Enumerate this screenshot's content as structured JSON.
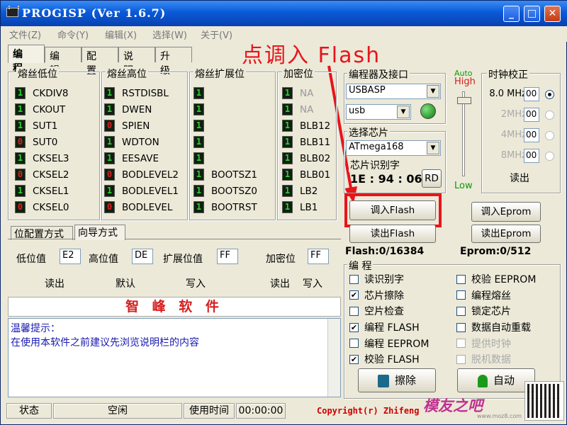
{
  "window": {
    "title": "PROGISP  (Ver 1.6.7)",
    "controls": {
      "minimize": "_",
      "maximize": "□",
      "close": "✕"
    }
  },
  "menu": [
    "文件(Z)",
    "命令(Y)",
    "编辑(X)",
    "选择(W)",
    "关于(V)"
  ],
  "tabs": [
    "编 程",
    "编 辑",
    "配 置",
    "说 明",
    "升 级"
  ],
  "annotation": "点调入 Flash",
  "fuse_groups": {
    "low": {
      "title": "熔丝低位",
      "rows": [
        {
          "v": "1",
          "n": "CKDIV8"
        },
        {
          "v": "1",
          "n": "CKOUT"
        },
        {
          "v": "1",
          "n": "SUT1"
        },
        {
          "v": "0",
          "n": "SUT0"
        },
        {
          "v": "1",
          "n": "CKSEL3"
        },
        {
          "v": "0",
          "n": "CKSEL2"
        },
        {
          "v": "1",
          "n": "CKSEL1"
        },
        {
          "v": "0",
          "n": "CKSEL0"
        }
      ]
    },
    "high": {
      "title": "熔丝高位",
      "rows": [
        {
          "v": "1",
          "n": "RSTDISBL"
        },
        {
          "v": "1",
          "n": "DWEN"
        },
        {
          "v": "0",
          "n": "SPIEN"
        },
        {
          "v": "1",
          "n": "WDTON"
        },
        {
          "v": "1",
          "n": "EESAVE"
        },
        {
          "v": "0",
          "n": "BODLEVEL2"
        },
        {
          "v": "1",
          "n": "BODLEVEL1"
        },
        {
          "v": "0",
          "n": "BODLEVEL"
        }
      ]
    },
    "ext": {
      "title": "熔丝扩展位",
      "rows": [
        {
          "v": "1",
          "n": ""
        },
        {
          "v": "1",
          "n": ""
        },
        {
          "v": "1",
          "n": ""
        },
        {
          "v": "1",
          "n": ""
        },
        {
          "v": "1",
          "n": ""
        },
        {
          "v": "1",
          "n": "BOOTSZ1"
        },
        {
          "v": "1",
          "n": "BOOTSZ0"
        },
        {
          "v": "1",
          "n": "BOOTRST"
        }
      ]
    },
    "lock": {
      "title": "加密位",
      "rows": [
        {
          "v": "1",
          "n": "NA",
          "dis": true
        },
        {
          "v": "1",
          "n": "NA",
          "dis": true
        },
        {
          "v": "1",
          "n": "BLB12"
        },
        {
          "v": "1",
          "n": "BLB11"
        },
        {
          "v": "1",
          "n": "BLB02"
        },
        {
          "v": "1",
          "n": "BLB01"
        },
        {
          "v": "1",
          "n": "LB2"
        },
        {
          "v": "1",
          "n": "LB1"
        }
      ]
    }
  },
  "config_tabs": [
    "位配置方式",
    "向导方式"
  ],
  "values": {
    "low_label": "低位值",
    "low": "E2",
    "high_label": "高位值",
    "high": "DE",
    "ext_label": "扩展位值",
    "ext": "FF",
    "lock_label": "加密位",
    "lock": "FF"
  },
  "value_buttons": [
    "读出",
    "默认",
    "写入",
    "读出",
    "写入"
  ],
  "brand": "智 峰 软 件",
  "log": [
    "温馨提示：",
    "在使用本软件之前建议先浏览说明栏的内容"
  ],
  "programmer": {
    "title": "编程器及接口",
    "device": "USBASP",
    "port": "usb",
    "auto": "Auto",
    "high": "High",
    "low": "Low"
  },
  "chip": {
    "title": "选择芯片",
    "name": "ATmega168",
    "id_title": "芯片识别字",
    "id": "1E : 94 : 06",
    "rd": "RD"
  },
  "clock": {
    "title": "时钟校正",
    "options": [
      {
        "f": "8.0 MHz",
        "v": "00",
        "on": true,
        "dis": false
      },
      {
        "f": "2MHz",
        "v": "00",
        "on": false,
        "dis": true
      },
      {
        "f": "4MHz",
        "v": "00",
        "on": false,
        "dis": true
      },
      {
        "f": "8MHz",
        "v": "00",
        "on": false,
        "dis": true
      }
    ],
    "read": "读出"
  },
  "flash_buttons": {
    "load_flash": "调入Flash",
    "read_flash": "读出Flash",
    "load_eprom": "调入Eprom",
    "read_eprom": "读出Eprom"
  },
  "sizes": {
    "flash": "Flash:0/16384",
    "eprom": "Eprom:0/512"
  },
  "program": {
    "title": "编 程",
    "left": [
      {
        "label": "读识别字",
        "checked": false,
        "dis": false
      },
      {
        "label": "芯片擦除",
        "checked": true,
        "dis": false
      },
      {
        "label": "空片检查",
        "checked": false,
        "dis": false
      },
      {
        "label": "编程 FLASH",
        "checked": true,
        "dis": false
      },
      {
        "label": "编程 EEPROM",
        "checked": false,
        "dis": false
      },
      {
        "label": "校验 FLASH",
        "checked": true,
        "dis": false
      }
    ],
    "right": [
      {
        "label": "校验 EEPROM",
        "checked": false,
        "dis": false
      },
      {
        "label": "编程熔丝",
        "checked": false,
        "dis": false
      },
      {
        "label": "锁定芯片",
        "checked": false,
        "dis": false
      },
      {
        "label": "数据自动重载",
        "checked": false,
        "dis": false
      },
      {
        "label": "提供时钟",
        "checked": false,
        "dis": true
      },
      {
        "label": "脱机数据",
        "checked": false,
        "dis": true
      }
    ],
    "erase": "擦除",
    "auto": "自动"
  },
  "status": {
    "state_label": "状态",
    "state": "空闲",
    "time_label": "使用时间",
    "time": "00:00:00",
    "copyright": "Copyright(r) Zhifeng",
    "watermark": "模友之吧",
    "watermark_url": "www.moz8.com"
  },
  "colors": {
    "annotation": "#e8141b",
    "titlebar": "#0a5ad8",
    "brand": "#d42020",
    "log_text": "#1a1ab0"
  }
}
